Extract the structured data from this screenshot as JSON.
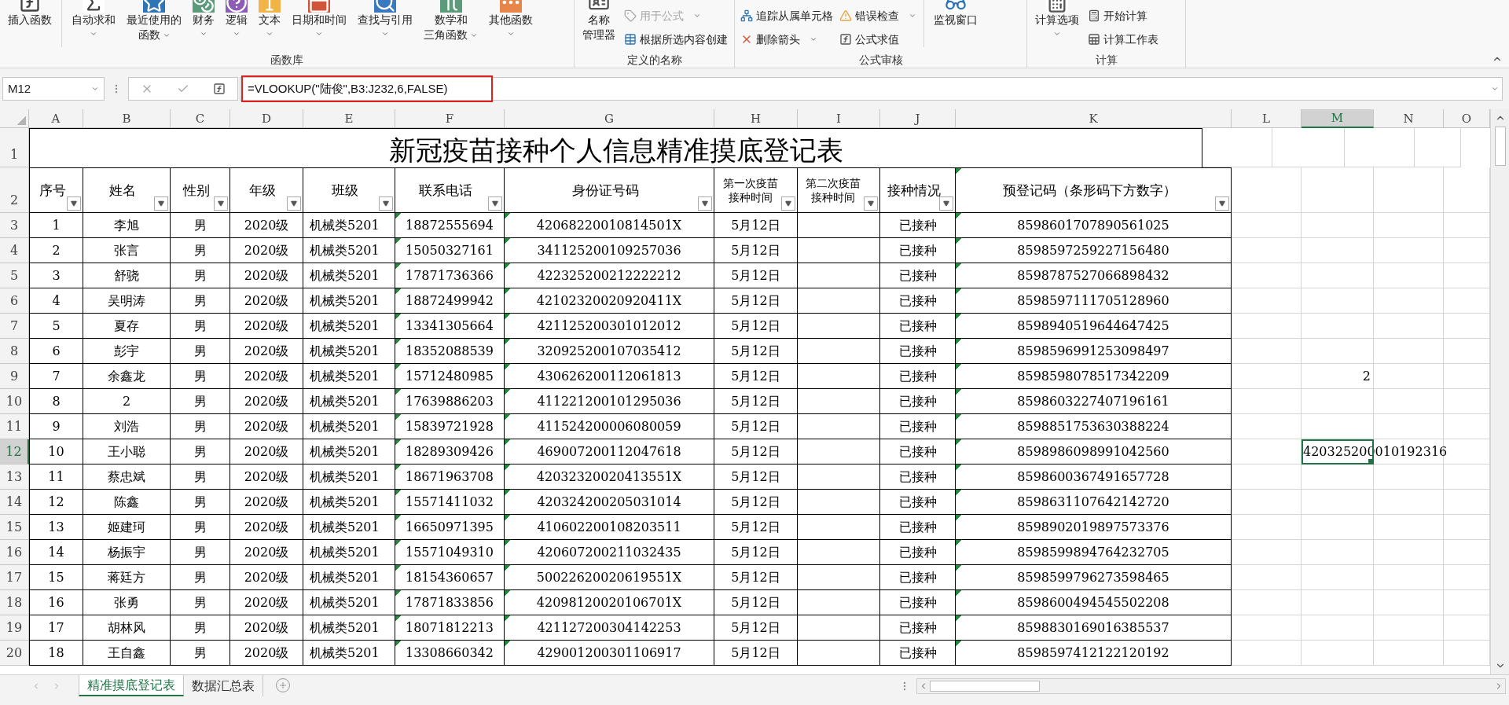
{
  "ribbon": {
    "groups": [
      {
        "label": "函数库",
        "items": [
          {
            "kind": "large",
            "lines": [
              "插入函数"
            ],
            "dropdown": false
          },
          {
            "kind": "separator"
          },
          {
            "kind": "large",
            "lines": [
              "自动求和"
            ],
            "dropdown": true
          },
          {
            "kind": "large",
            "lines": [
              "最近使用的",
              "函数"
            ],
            "dropdown": true
          },
          {
            "kind": "large",
            "lines": [
              "财务"
            ],
            "dropdown": true
          },
          {
            "kind": "large",
            "lines": [
              "逻辑"
            ],
            "dropdown": true
          },
          {
            "kind": "large",
            "lines": [
              "文本"
            ],
            "dropdown": true
          },
          {
            "kind": "large",
            "lines": [
              "日期和时间"
            ],
            "dropdown": true
          },
          {
            "kind": "large",
            "lines": [
              "查找与引用"
            ],
            "dropdown": true
          },
          {
            "kind": "large",
            "lines": [
              "数学和",
              "三角函数"
            ],
            "dropdown": true
          },
          {
            "kind": "large",
            "lines": [
              "其他函数"
            ],
            "dropdown": true
          }
        ]
      },
      {
        "label": "定义的名称",
        "items": [
          {
            "kind": "large",
            "lines": [
              "名称",
              "管理器"
            ],
            "dropdown": false
          },
          {
            "kind": "stack",
            "items": [
              {
                "label": "用于公式",
                "dropdown": true,
                "disabled": true
              },
              {
                "label": "根据所选内容创建",
                "dropdown": false,
                "disabled": false
              }
            ]
          }
        ]
      },
      {
        "label": "公式审核",
        "items": [
          {
            "kind": "stack",
            "items": [
              {
                "label": "追踪从属单元格",
                "dropdown": false,
                "disabled": false
              },
              {
                "label": "删除箭头",
                "dropdown": true,
                "disabled": false
              }
            ]
          },
          {
            "kind": "stack",
            "items": [
              {
                "label": "错误检查",
                "dropdown": true,
                "disabled": false
              },
              {
                "label": "公式求值",
                "dropdown": false,
                "disabled": false
              }
            ]
          },
          {
            "kind": "separator"
          },
          {
            "kind": "large",
            "lines": [
              "监视窗口"
            ],
            "dropdown": false
          }
        ]
      },
      {
        "label": "计算",
        "items": [
          {
            "kind": "large",
            "lines": [
              "计算选项"
            ],
            "dropdown": true
          },
          {
            "kind": "stack",
            "items": [
              {
                "label": "开始计算",
                "dropdown": false,
                "disabled": false
              },
              {
                "label": "计算工作表",
                "dropdown": false,
                "disabled": false
              }
            ]
          }
        ]
      }
    ]
  },
  "formula_bar": {
    "name_box": "M12",
    "formula": "=VLOOKUP(\"陆俊\",B3:J232,6,FALSE)"
  },
  "columns": [
    {
      "label": "A",
      "selected": false
    },
    {
      "label": "B",
      "selected": false
    },
    {
      "label": "C",
      "selected": false
    },
    {
      "label": "D",
      "selected": false
    },
    {
      "label": "E",
      "selected": false
    },
    {
      "label": "F",
      "selected": false
    },
    {
      "label": "G",
      "selected": false
    },
    {
      "label": "H",
      "selected": false
    },
    {
      "label": "I",
      "selected": false
    },
    {
      "label": "J",
      "selected": false
    },
    {
      "label": "K",
      "selected": false
    },
    {
      "label": "L",
      "selected": false
    },
    {
      "label": "M",
      "selected": true
    },
    {
      "label": "N",
      "selected": false
    },
    {
      "label": "O",
      "selected": false
    }
  ],
  "title_row": {
    "number": "1",
    "title": "新冠疫苗接种个人信息精准摸底登记表"
  },
  "header_row": {
    "number": "2",
    "headers": [
      {
        "label": "序号",
        "flagged": false
      },
      {
        "label": "姓名",
        "flagged": false
      },
      {
        "label": "性别",
        "flagged": false
      },
      {
        "label": "年级",
        "flagged": false
      },
      {
        "label": "班级",
        "flagged": false
      },
      {
        "label": "联系电话",
        "flagged": true
      },
      {
        "label": "身份证号码",
        "flagged": true
      },
      {
        "label": "第一次疫苗接种时间",
        "flagged": false
      },
      {
        "label": "第二次疫苗接种时间",
        "flagged": false
      },
      {
        "label": "接种情况",
        "flagged": false
      },
      {
        "label": "预登记码（条形码下方数字）",
        "flagged": true
      }
    ]
  },
  "rows": [
    {
      "number": "3",
      "selected": false,
      "cells": [
        "1",
        "李旭",
        "男",
        "2020级",
        "机械类5201",
        "18872555694",
        "42068220010814501X",
        "5月12日",
        null,
        "已接种",
        "8598601707890561025"
      ]
    },
    {
      "number": "4",
      "selected": false,
      "cells": [
        "2",
        "张言",
        "男",
        "2020级",
        "机械类5201",
        "15050327161",
        "341125200109257036",
        "5月12日",
        null,
        "已接种",
        "8598597259227156480"
      ]
    },
    {
      "number": "5",
      "selected": false,
      "cells": [
        "3",
        "舒骁",
        "男",
        "2020级",
        "机械类5201",
        "17871736366",
        "422325200212222212",
        "5月12日",
        null,
        "已接种",
        "8598787527066898432"
      ]
    },
    {
      "number": "6",
      "selected": false,
      "cells": [
        "4",
        "吴明涛",
        "男",
        "2020级",
        "机械类5201",
        "18872499942",
        "42102320020920411X",
        "5月12日",
        null,
        "已接种",
        "8598597111705128960"
      ]
    },
    {
      "number": "7",
      "selected": false,
      "cells": [
        "5",
        "夏存",
        "男",
        "2020级",
        "机械类5201",
        "13341305664",
        "421125200301012012",
        "5月12日",
        null,
        "已接种",
        "8598940519644647425"
      ]
    },
    {
      "number": "8",
      "selected": false,
      "cells": [
        "6",
        "彭宇",
        "男",
        "2020级",
        "机械类5201",
        "18352088539",
        "320925200107035412",
        "5月12日",
        null,
        "已接种",
        "8598596991253098497"
      ]
    },
    {
      "number": "9",
      "selected": false,
      "cells": [
        "7",
        "余鑫龙",
        "男",
        "2020级",
        "机械类5201",
        "15712480985",
        "430626200112061813",
        "5月12日",
        null,
        "已接种",
        "8598598078517342209"
      ],
      "column_m": {
        "value": "2",
        "kind": "number",
        "selected": false
      }
    },
    {
      "number": "10",
      "selected": false,
      "cells": [
        "8",
        "2",
        "男",
        "2020级",
        "机械类5201",
        "17639886203",
        "411221200101295036",
        "5月12日",
        null,
        "已接种",
        "8598603227407196161"
      ]
    },
    {
      "number": "11",
      "selected": false,
      "cells": [
        "9",
        "刘浩",
        "男",
        "2020级",
        "机械类5201",
        "15839721928",
        "411524200006080059",
        "5月12日",
        null,
        "已接种",
        "8598851753630388224"
      ]
    },
    {
      "number": "12",
      "selected": true,
      "cells": [
        "10",
        "王小聪",
        "男",
        "2020级",
        "机械类5201",
        "18289309426",
        "469007200112047618",
        "5月12日",
        null,
        "已接种",
        "8598986098991042560"
      ],
      "column_m": {
        "value": "420325200010192316",
        "kind": "text",
        "selected": true
      }
    },
    {
      "number": "13",
      "selected": false,
      "cells": [
        "11",
        "蔡忠斌",
        "男",
        "2020级",
        "机械类5201",
        "18671963708",
        "42032320020413551X",
        "5月12日",
        null,
        "已接种",
        "8598600367491657728"
      ]
    },
    {
      "number": "14",
      "selected": false,
      "cells": [
        "12",
        "陈鑫",
        "男",
        "2020级",
        "机械类5201",
        "15571411032",
        "420324200205031014",
        "5月12日",
        null,
        "已接种",
        "8598631107642142720"
      ]
    },
    {
      "number": "15",
      "selected": false,
      "cells": [
        "13",
        "姬建珂",
        "男",
        "2020级",
        "机械类5201",
        "16650971395",
        "410602200108203511",
        "5月12日",
        null,
        "已接种",
        "8598902019897573376"
      ]
    },
    {
      "number": "16",
      "selected": false,
      "cells": [
        "14",
        "杨振宇",
        "男",
        "2020级",
        "机械类5201",
        "15571049310",
        "420607200211032435",
        "5月12日",
        null,
        "已接种",
        "8598599894764232705"
      ]
    },
    {
      "number": "17",
      "selected": false,
      "cells": [
        "15",
        "蒋廷方",
        "男",
        "2020级",
        "机械类5201",
        "18154360657",
        "50022620020619551X",
        "5月12日",
        null,
        "已接种",
        "8598599796273598465"
      ]
    },
    {
      "number": "18",
      "selected": false,
      "cells": [
        "16",
        "张勇",
        "男",
        "2020级",
        "机械类5201",
        "17871833856",
        "42098120020106701X",
        "5月12日",
        null,
        "已接种",
        "8598600494545502208"
      ]
    },
    {
      "number": "19",
      "selected": false,
      "cells": [
        "17",
        "胡林风",
        "男",
        "2020级",
        "机械类5201",
        "18071812213",
        "421127200304142253",
        "5月12日",
        null,
        "已接种",
        "8598830169016385537"
      ]
    },
    {
      "number": "20",
      "selected": false,
      "cells": [
        "18",
        "王自鑫",
        "男",
        "2020级",
        "机械类5201",
        "13308660342",
        "429001200301106917",
        "5月12日",
        null,
        "已接种",
        "8598597412122120192"
      ]
    }
  ],
  "sheet_tabs": [
    {
      "label": "精准摸底登记表",
      "selected": true
    },
    {
      "label": "数据汇总表",
      "selected": false
    }
  ]
}
